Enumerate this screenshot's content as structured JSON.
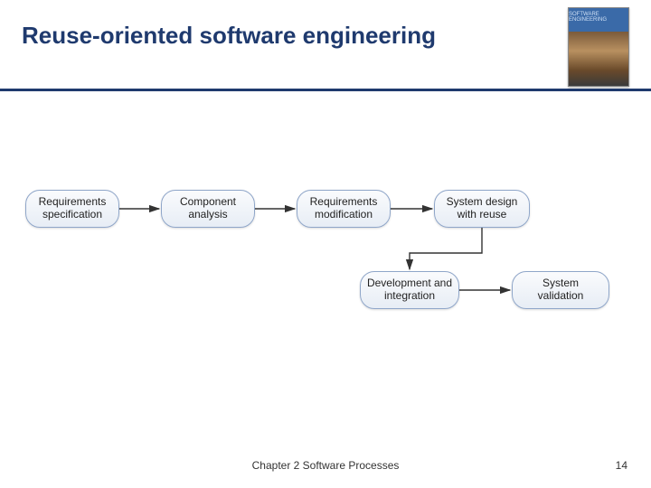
{
  "title": "Reuse-oriented software engineering",
  "book_cover_label": "SOFTWARE ENGINEERING",
  "footer": {
    "center": "Chapter 2 Software Processes",
    "page": "14"
  },
  "chart_data": {
    "type": "diagram",
    "title": "Reuse-oriented software engineering process",
    "nodes": [
      {
        "id": "n1",
        "label": "Requirements specification"
      },
      {
        "id": "n2",
        "label": "Component analysis"
      },
      {
        "id": "n3",
        "label": "Requirements modification"
      },
      {
        "id": "n4",
        "label": "System design with reuse"
      },
      {
        "id": "n5",
        "label": "Development and integration"
      },
      {
        "id": "n6",
        "label": "System validation"
      }
    ],
    "edges": [
      {
        "from": "n1",
        "to": "n2"
      },
      {
        "from": "n2",
        "to": "n3"
      },
      {
        "from": "n3",
        "to": "n4"
      },
      {
        "from": "n4",
        "to": "n5"
      },
      {
        "from": "n5",
        "to": "n6"
      }
    ]
  }
}
